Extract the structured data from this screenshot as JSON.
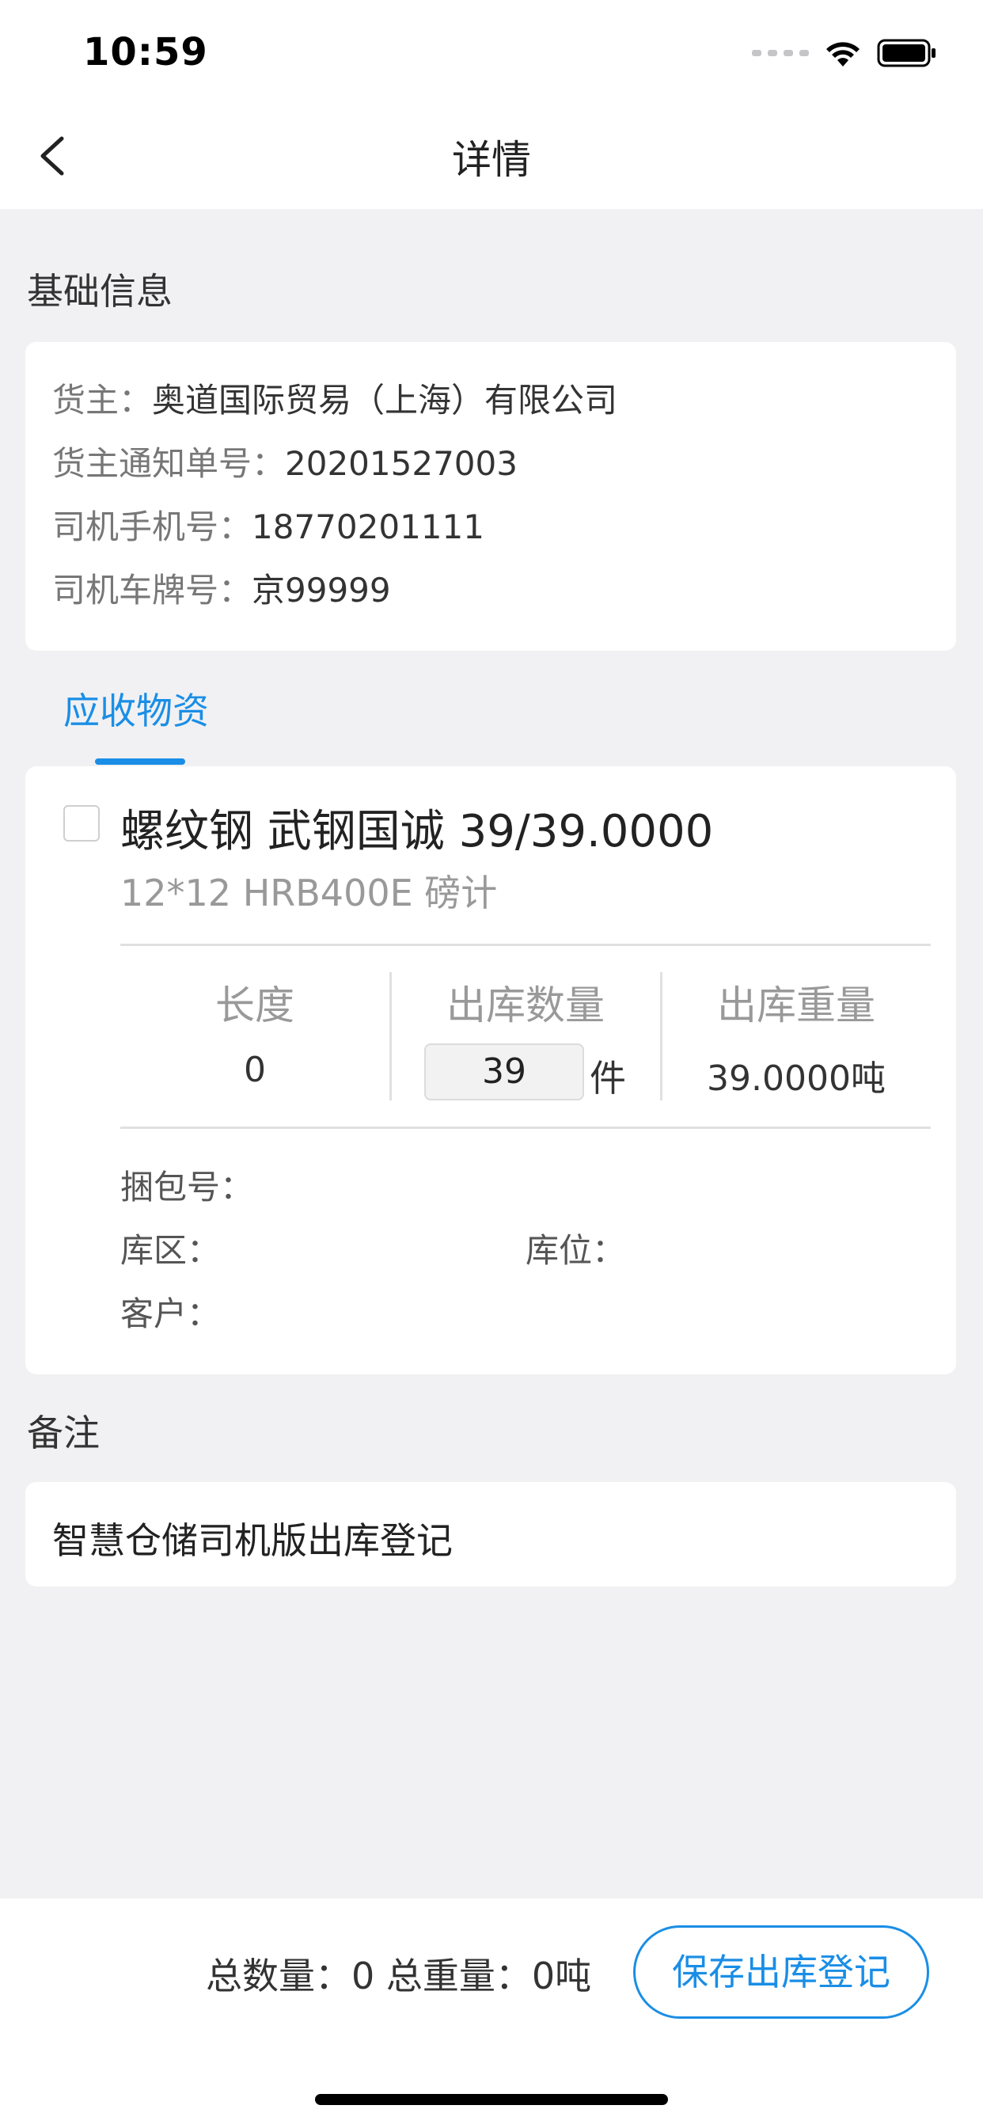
{
  "status_bar": {
    "time": "10:59"
  },
  "nav": {
    "title": "详情"
  },
  "basic_info": {
    "heading": "基础信息",
    "rows": [
      {
        "label": "货主：",
        "value": "奥道国际贸易（上海）有限公司"
      },
      {
        "label": "货主通知单号：",
        "value": "20201527003"
      },
      {
        "label": "司机手机号：",
        "value": "18770201111"
      },
      {
        "label": "司机车牌号：",
        "value": "京99999"
      }
    ]
  },
  "tab": {
    "label": "应收物资"
  },
  "item": {
    "title": "螺纹钢 武钢国诚 39/39.0000",
    "subtitle": "12*12 HRB400E 磅计",
    "length_label": "长度",
    "length_value": "0",
    "qty_label": "出库数量",
    "qty_value": "39",
    "qty_unit": "件",
    "weight_label": "出库重量",
    "weight_value": "39.0000吨",
    "bundle_label": "捆包号：",
    "area_label": "库区：",
    "location_label": "库位：",
    "customer_label": "客户："
  },
  "remark": {
    "heading": "备注",
    "text": "智慧仓储司机版出库登记"
  },
  "bottom": {
    "summary": "总数量：0 总重量：0吨",
    "save_label": "保存出库登记"
  },
  "colors": {
    "accent": "#1a8ee6",
    "background": "#f1f1f3"
  }
}
